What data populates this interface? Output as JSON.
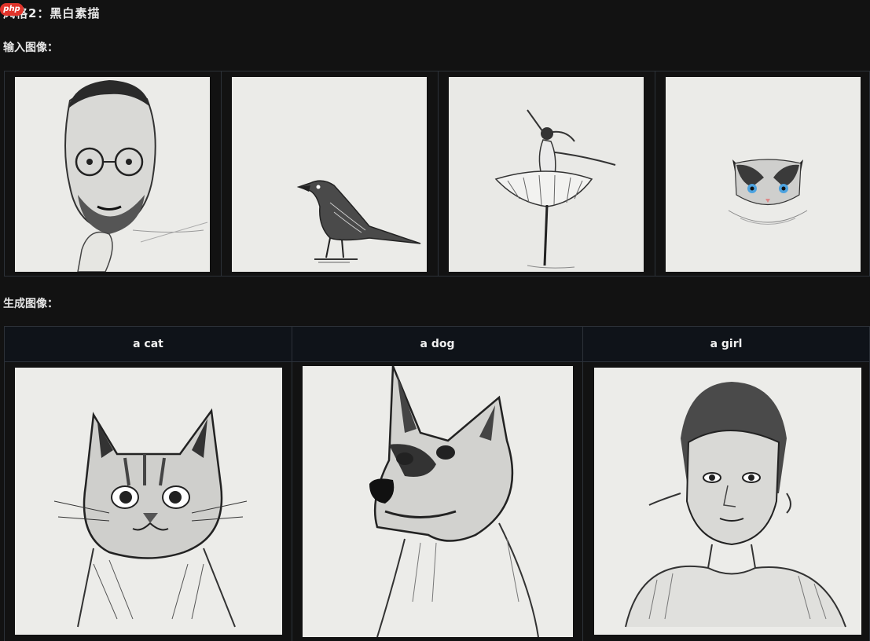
{
  "badge": "php",
  "title": "风格2：黑白素描",
  "input_section": {
    "label": "输入图像：",
    "images": [
      {
        "subject": "man-portrait-sketch"
      },
      {
        "subject": "crow-sketch"
      },
      {
        "subject": "ballerina-sketch"
      },
      {
        "subject": "cat-sketch"
      }
    ]
  },
  "generated_section": {
    "label": "生成图像：",
    "columns": [
      {
        "prompt": "a cat"
      },
      {
        "prompt": "a dog"
      },
      {
        "prompt": "a girl"
      }
    ]
  }
}
